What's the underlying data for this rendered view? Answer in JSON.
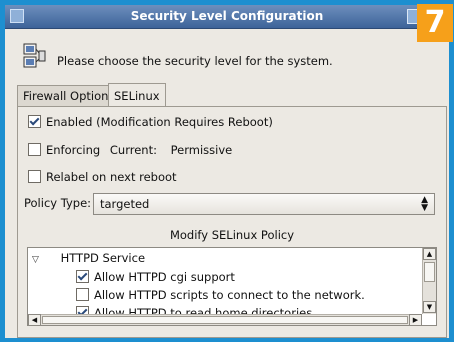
{
  "window": {
    "title": "Security Level Configuration"
  },
  "badge": "7",
  "header": {
    "prompt": "Please choose the security level for the system."
  },
  "tabs": [
    {
      "label": "Firewall Options",
      "active": false
    },
    {
      "label": "SELinux",
      "active": true
    }
  ],
  "selinux": {
    "enabled_label": "Enabled (Modification Requires Reboot)",
    "enabled_checked": true,
    "enforcing_label": "Enforcing",
    "enforcing_checked": false,
    "current_label": "Current:",
    "current_value": "Permissive",
    "relabel_label": "Relabel on next reboot",
    "relabel_checked": false,
    "policy_type_label": "Policy Type:",
    "policy_type_value": "targeted",
    "modify_label": "Modify SELinux Policy"
  },
  "policy_tree": {
    "group": "HTTPD Service",
    "items": [
      {
        "label": "Allow HTTPD cgi support",
        "checked": true
      },
      {
        "label": "Allow HTTPD scripts to connect to the network.",
        "checked": false
      },
      {
        "label": "Allow HTTPD to read home directories",
        "checked": true
      }
    ]
  },
  "icons": {
    "window": "app-icon",
    "header": "security-computers-icon",
    "expander": "triangle-down-icon",
    "dropdown": "updown-arrows-icon"
  },
  "colors": {
    "desktop": "#1d8fd0",
    "badge": "#f6a01a",
    "titlebar": "#4a72a8",
    "window_bg": "#ece9e3"
  }
}
